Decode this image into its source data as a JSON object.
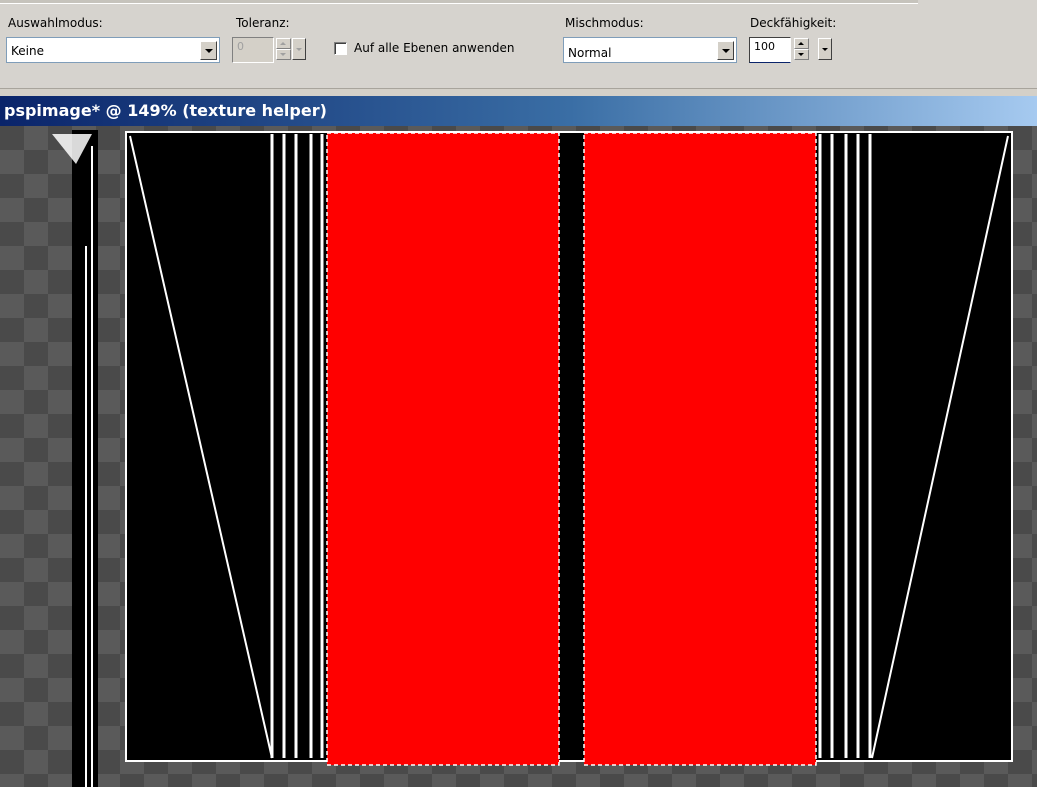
{
  "toolbar": {
    "selection_mode_label": "Auswahlmodus:",
    "selection_mode_value": "Keine",
    "tolerance_label": "Toleranz:",
    "tolerance_value": "0",
    "apply_all_layers_label": "Auf alle Ebenen anwenden",
    "apply_all_layers_checked": false,
    "blend_mode_label": "Mischmodus:",
    "blend_mode_value": "Normal",
    "opacity_label": "Deckfähigkeit:",
    "opacity_value": "100"
  },
  "document": {
    "title": "pspimage* @ 149% (texture helper)"
  },
  "colors": {
    "accent_red": "#ff0000",
    "canvas_black": "#000000",
    "line_white": "#ffffff",
    "titlebar_start": "#0a246a",
    "titlebar_end": "#a6caf0"
  },
  "icons": {
    "dropdown": "chevron-down-icon",
    "spinner": "spin-updown-icon",
    "checkbox": "checkbox-unchecked-icon"
  }
}
